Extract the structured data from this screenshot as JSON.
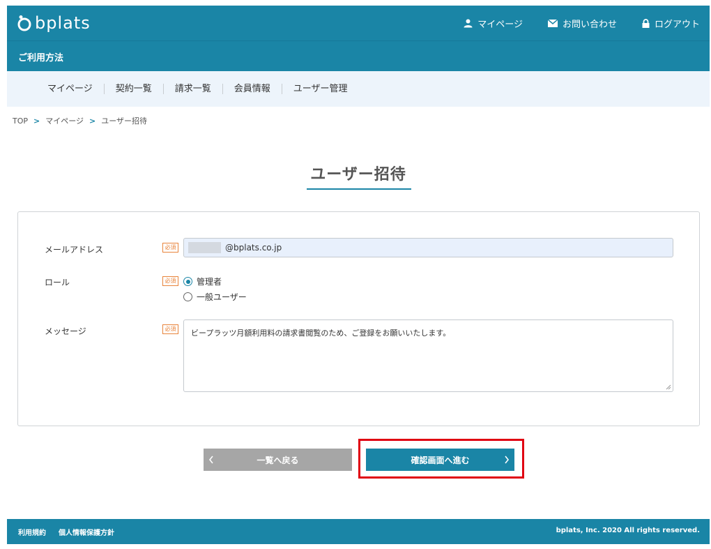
{
  "brand": {
    "logo_text": "bplats"
  },
  "header": {
    "links": [
      {
        "label": "マイページ",
        "icon": "user-icon"
      },
      {
        "label": "お問い合わせ",
        "icon": "mail-icon"
      },
      {
        "label": "ログアウト",
        "icon": "lock-icon"
      }
    ]
  },
  "subheader": {
    "title": "ご利用方法"
  },
  "menu": {
    "items": [
      {
        "label": "マイページ"
      },
      {
        "label": "契約一覧"
      },
      {
        "label": "請求一覧"
      },
      {
        "label": "会員情報"
      },
      {
        "label": "ユーザー管理"
      }
    ]
  },
  "breadcrumb": {
    "items": [
      {
        "label": "TOP"
      },
      {
        "label": "マイページ"
      },
      {
        "label": "ユーザー招待"
      }
    ],
    "separator": ">"
  },
  "page": {
    "title": "ユーザー招待"
  },
  "form": {
    "required_badge": "必須",
    "email": {
      "label": "メールアドレス",
      "value": "@bplats.co.jp"
    },
    "role": {
      "label": "ロール",
      "options": [
        {
          "label": "管理者",
          "checked": true
        },
        {
          "label": "一般ユーザー",
          "checked": false
        }
      ]
    },
    "message": {
      "label": "メッセージ",
      "value": "ビープラッツ月額利用料の請求書閲覧のため、ご登録をお願いいたします。"
    }
  },
  "buttons": {
    "back_label": "一覧へ戻る",
    "next_label": "確認画面へ進む"
  },
  "footer": {
    "links": [
      {
        "label": "利用規約"
      },
      {
        "label": "個人情報保護方針"
      }
    ],
    "copyright": "bplats, Inc. 2020 All rights reserved."
  },
  "colors": {
    "primary": "#1a85a6",
    "menu_bg": "#edf4fb",
    "required": "#e8833a",
    "highlight": "#e00012",
    "back_button": "#a6a6a6"
  }
}
